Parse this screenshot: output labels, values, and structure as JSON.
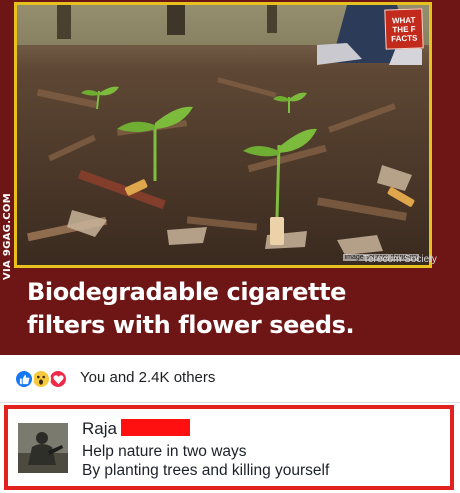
{
  "meme": {
    "brand_lines": [
      "WHAT",
      "THE F",
      "FACTS"
    ],
    "image_source": "image source: dzinetrip",
    "side_watermark": "VIA 9GAG.COM",
    "society_watermark": "Terecom Society",
    "headline_line1": "Biodegradable cigarette",
    "headline_line2": "filters with flower seeds."
  },
  "reactions": {
    "icons": [
      "like-icon",
      "wow-icon",
      "love-icon"
    ],
    "text": "You and 2.4K others"
  },
  "comment": {
    "author": "Raja",
    "line1": "Help nature in two ways",
    "line2": "By planting trees and killing yourself"
  },
  "colors": {
    "meme_background": "#6e1616",
    "frame_yellow": "#e7c21f",
    "highlight_red": "#e1221f",
    "like_blue": "#1877f2"
  }
}
